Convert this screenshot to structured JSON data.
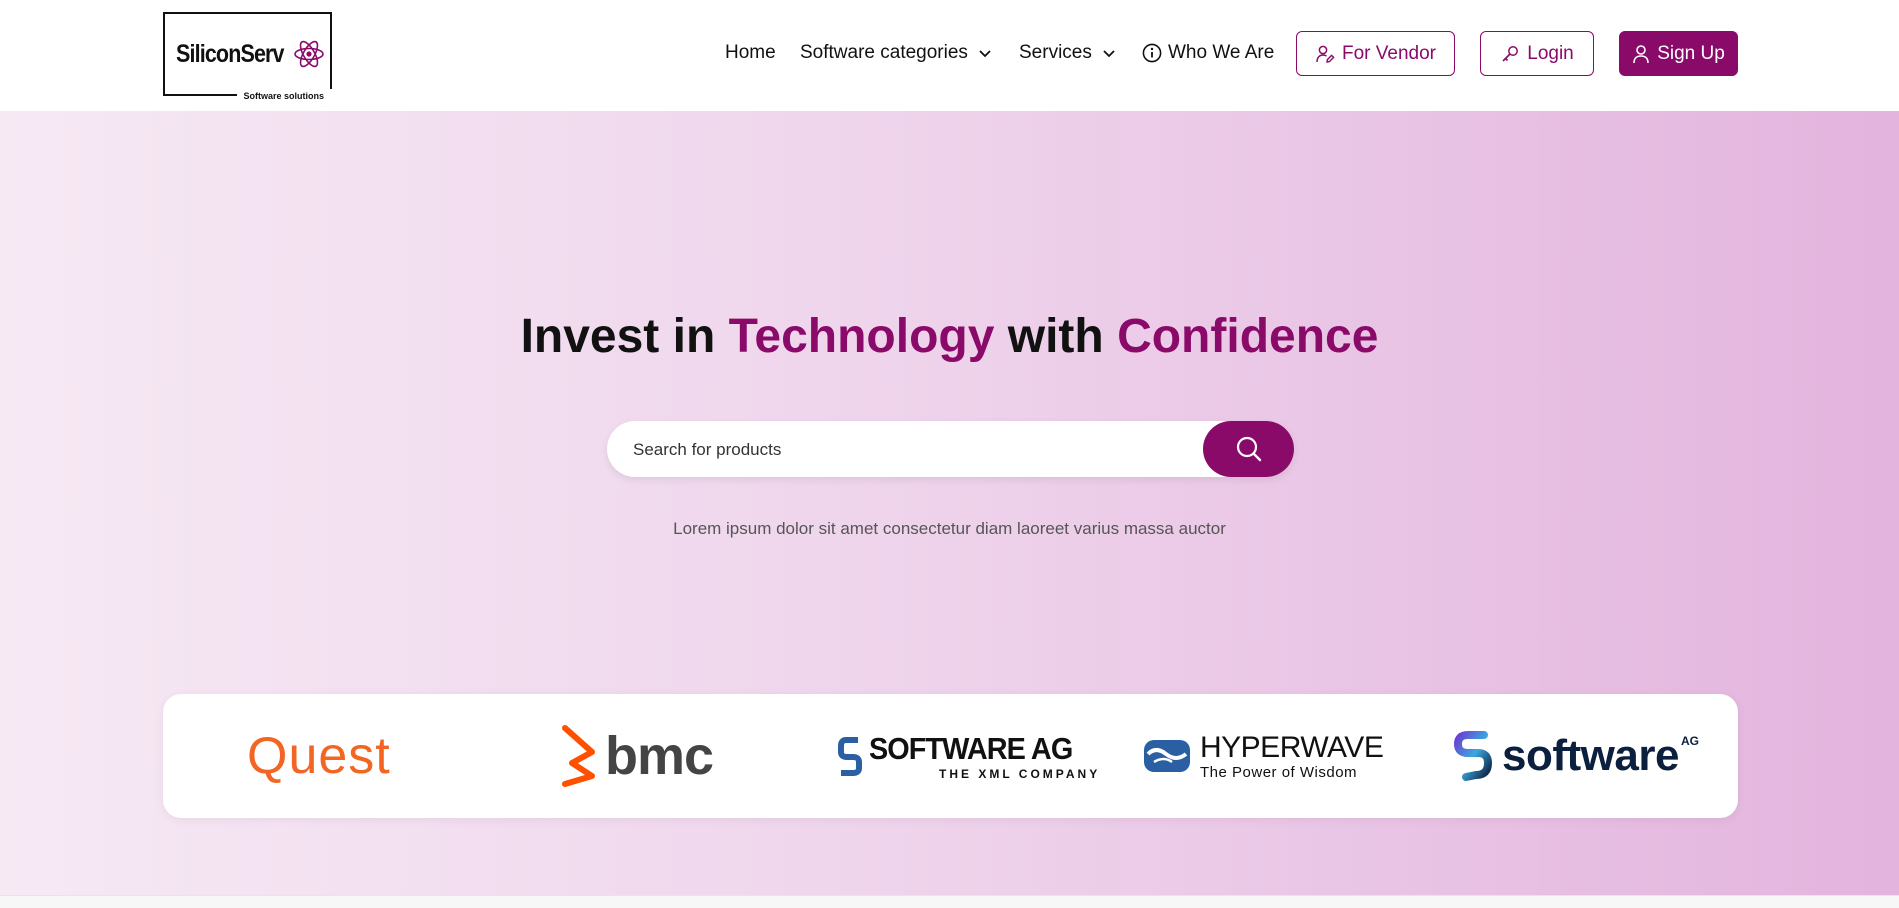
{
  "header": {
    "logo": {
      "name": "SiliconServ",
      "tagline": "Software solutions"
    },
    "nav": {
      "home": "Home",
      "software_categories": "Software categories",
      "services": "Services",
      "who_we_are": "Who We Are"
    },
    "buttons": {
      "vendor": "For Vendor",
      "login": "Login",
      "signup": "Sign Up"
    }
  },
  "hero": {
    "title": {
      "part1": "Invest in ",
      "accent1": "Technology",
      "part2": " with ",
      "accent2": "Confidence"
    },
    "search": {
      "placeholder": "Search for products",
      "value": ""
    },
    "subtitle": "Lorem ipsum dolor sit amet consectetur diam laoreet varius massa auctor"
  },
  "brands": {
    "quest": "Quest",
    "bmc": "bmc",
    "software_ag_xml": {
      "name": "SOFTWARE AG",
      "tagline": "THE XML COMPANY"
    },
    "hyperwave": {
      "name": "HYPERWAVE",
      "tagline": "The Power of Wisdom"
    },
    "software_ag": {
      "name": "software",
      "suffix": "AG"
    }
  },
  "colors": {
    "brand": "#8a0a6a",
    "quest": "#f26522",
    "bmc": "#fe5000",
    "hyperwave": "#2a5fa3",
    "software_ag_navy": "#0b1f3f"
  }
}
